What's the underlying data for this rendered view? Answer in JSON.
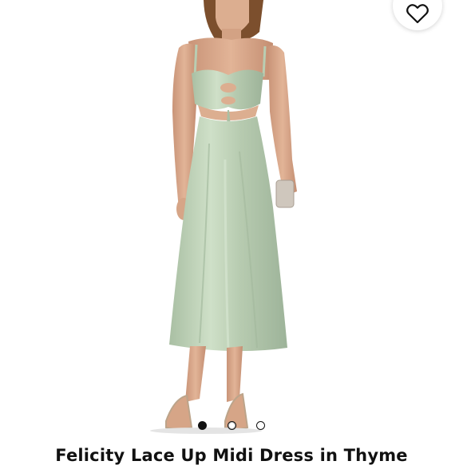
{
  "product": {
    "title": "Felicity Lace Up Midi Dress in Thyme",
    "image_alt": "Model wearing a sage green satin midi slip dress with lace-up cutout bodice, holding a metallic clutch"
  },
  "wishlist": {
    "icon": "heart-outline-icon"
  },
  "carousel": {
    "dots": [
      {
        "state": "filled"
      },
      {
        "state": "selected"
      },
      {
        "state": "hollow"
      }
    ]
  },
  "colors": {
    "dress": "#b9cdb2",
    "dress_shadow": "#9fb59a",
    "skin": "#d9a98a",
    "hair": "#8a5a35",
    "text": "#111111"
  }
}
